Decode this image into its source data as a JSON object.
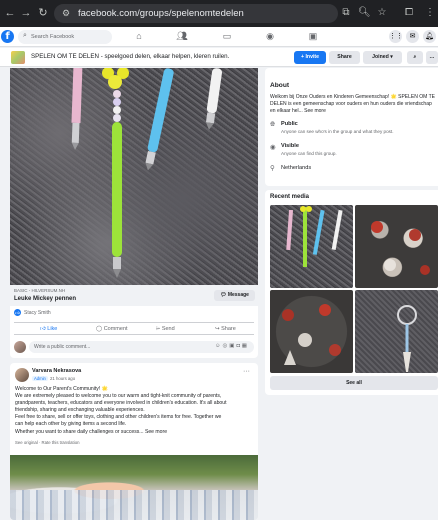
{
  "browser": {
    "url": "facebook.com/groups/spelenomtedelen"
  },
  "fb": {
    "search_placeholder": "Search Facebook"
  },
  "group": {
    "name": "SPELEN OM TE DELEN - speelgoed delen, elkaar helpen, kleren ruilen.",
    "invite_label": "+ Invite",
    "share_label": "Share",
    "joined_label": "Joined"
  },
  "post1": {
    "link_domain": "BASIC - HILVERSUM.NH",
    "link_title": "Leuke Mickey pennen",
    "message_label": "Message",
    "reactor": "Stacy Smith",
    "actions": {
      "like": "Like",
      "comment": "Comment",
      "send": "Send",
      "share": "Share"
    },
    "comment_placeholder": "Write a public comment..."
  },
  "post2": {
    "author": "Varvara Nekrasova",
    "badge": "Admin",
    "time": "21 hours ago",
    "text_lines": [
      "Welcome to Our Parent's Community! 🌟",
      "We are extremely pleased to welcome you to our warm and tight-knit community of parents,",
      "grandparents, teachers, educators and everyone involved in children's education. It's all about",
      "friendship, sharing and exchanging valuable experiences.",
      "Feel free to share, sell or offer toys, clothing and other children's items for free. Together we",
      "can help each other by giving items a second life.",
      "Whether you want to share daily challenges or success... See more"
    ],
    "see_original": "See original · Rate this translation"
  },
  "about": {
    "title": "About",
    "description": "Welkom bij Onze Ouders en Kinderen Gemeenschap! 🌟 SPELEN OM TE DELEN is een gemeenschap voor ouders en hun ouders die vriendschap en elkaar hel... See more",
    "public_title": "Public",
    "public_sub": "Anyone can see who's in the group and what they post.",
    "visible_title": "Visible",
    "visible_sub": "Anyone can find this group.",
    "location": "Netherlands"
  },
  "media": {
    "title": "Recent media",
    "see_all": "See all"
  },
  "colors": {
    "fb_blue": "#1877f2",
    "chrome_dark": "#202124",
    "page_bg": "#f0f2f5"
  },
  "icons": [
    "back-icon",
    "forward-icon",
    "reload-icon",
    "tune-icon",
    "search-icon",
    "star-icon",
    "extensions-icon",
    "messenger-icon",
    "bell-icon",
    "menu-icon",
    "home-icon",
    "friends-icon",
    "video-icon",
    "groups-icon",
    "gaming-icon",
    "globe-icon",
    "eye-icon",
    "location-icon",
    "like-icon",
    "comment-icon",
    "send-icon",
    "share-icon",
    "more-icon"
  ]
}
